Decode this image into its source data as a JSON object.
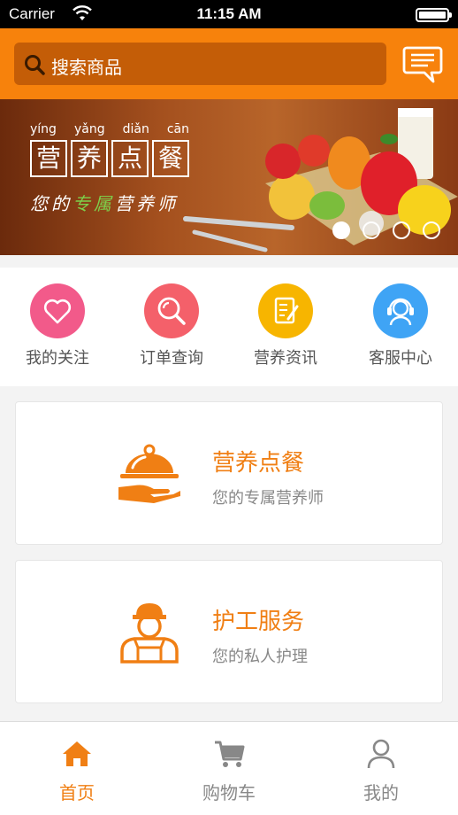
{
  "status_bar": {
    "carrier": "Carrier",
    "time": "11:15 AM"
  },
  "search": {
    "placeholder": "搜索商品",
    "icon": "search-icon"
  },
  "header": {
    "message_icon": "message-icon"
  },
  "banner": {
    "pinyin": [
      "yíng",
      "yǎng",
      "diǎn",
      "cān"
    ],
    "title_chars": [
      "营",
      "养",
      "点",
      "餐"
    ],
    "subtitle_before": "您的",
    "subtitle_highlight": "专属",
    "subtitle_after": "营养师",
    "active_slide": 1,
    "slide_count": 4
  },
  "quick_actions": [
    {
      "label": "我的关注",
      "icon": "heart-icon",
      "color": "#f25a8a"
    },
    {
      "label": "订单查询",
      "icon": "magnifier-icon",
      "color": "#f4606a"
    },
    {
      "label": "营养资讯",
      "icon": "document-edit-icon",
      "color": "#f7b500"
    },
    {
      "label": "客服中心",
      "icon": "headset-icon",
      "color": "#3fa4f5"
    }
  ],
  "cards": [
    {
      "title": "营养点餐",
      "desc": "您的专属营养师",
      "icon": "serving-dish-icon"
    },
    {
      "title": "护工服务",
      "desc": "您的私人护理",
      "icon": "caregiver-icon"
    }
  ],
  "tabs": [
    {
      "label": "首页",
      "icon": "home-icon",
      "active": true
    },
    {
      "label": "购物车",
      "icon": "cart-icon",
      "active": false
    },
    {
      "label": "我的",
      "icon": "user-icon",
      "active": false
    }
  ],
  "colors": {
    "accent": "#f7820c",
    "accent_dark": "#c45d07",
    "text_accent": "#f07f14"
  }
}
